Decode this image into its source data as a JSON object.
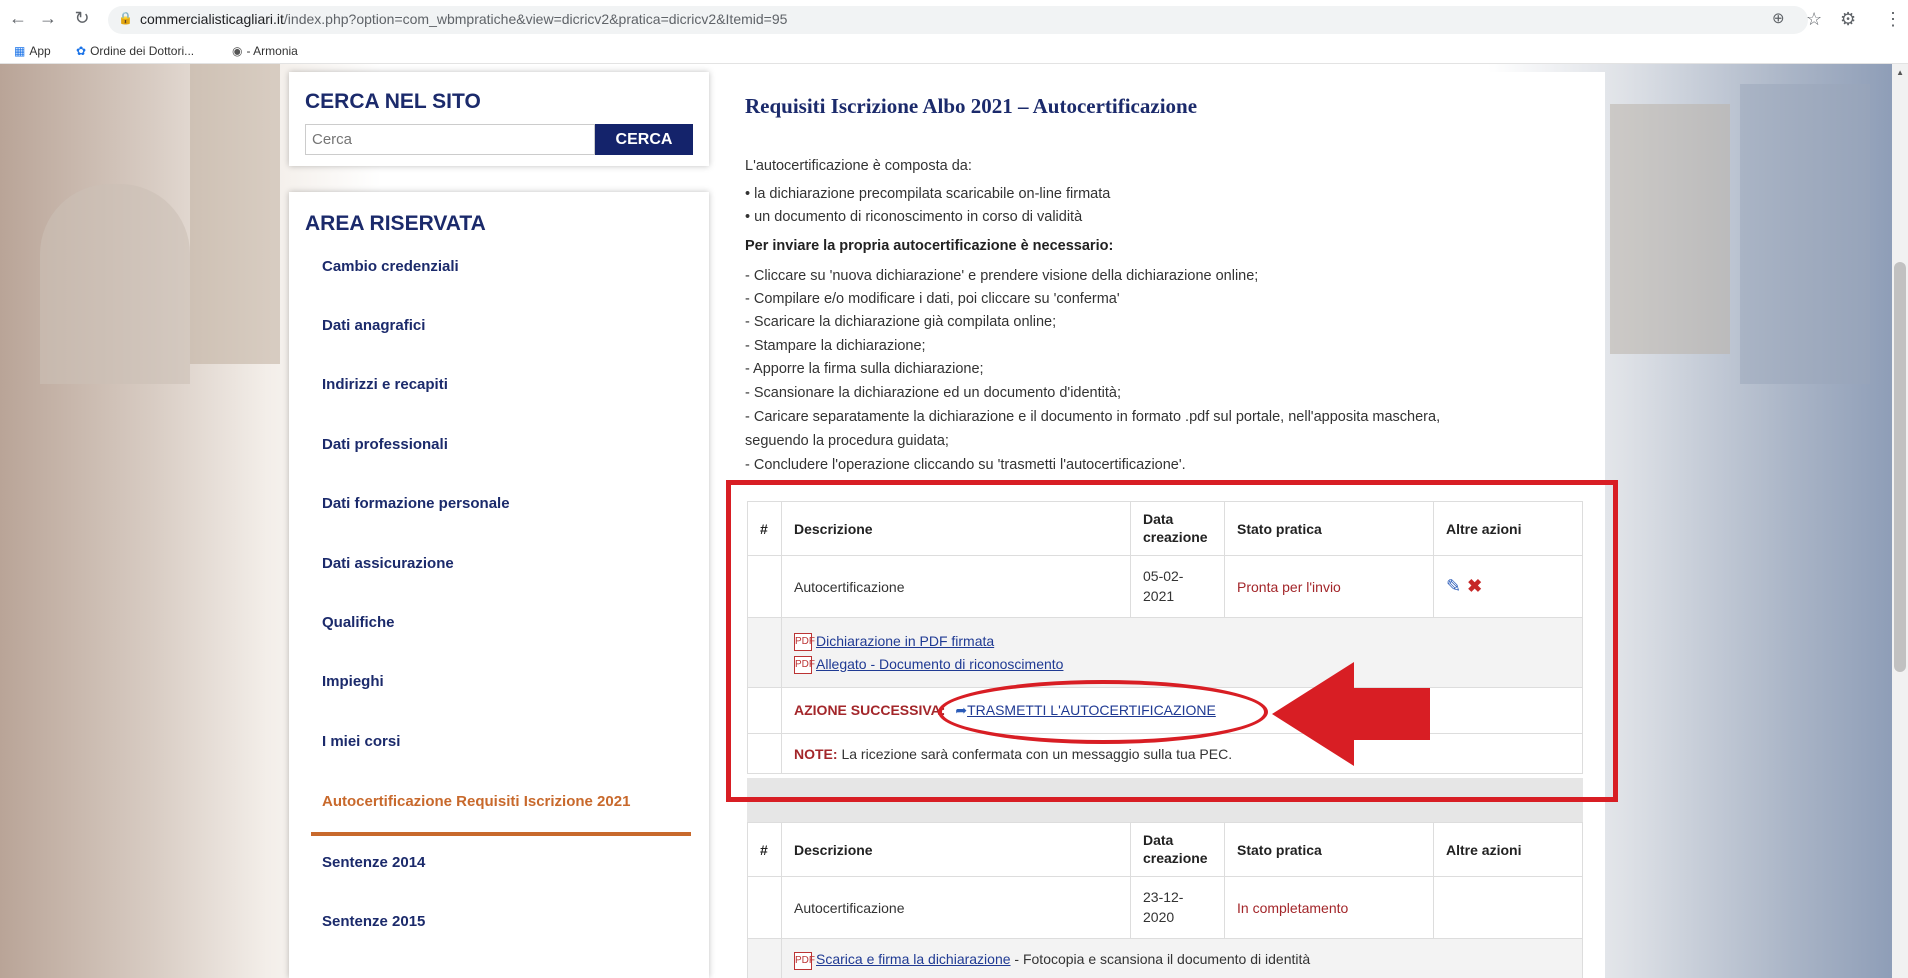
{
  "browser": {
    "url_domain": "commercialisticagliari.it",
    "url_rest": "/index.php?option=com_wbmpratiche&view=dicricv2&pratica=dicricv2&Itemid=95",
    "bookmarks": [
      "App",
      "Ordine dei Dottori...",
      "- Armonia"
    ]
  },
  "search": {
    "title": "CERCA NEL SITO",
    "placeholder": "Cerca",
    "button": "CERCA"
  },
  "area": {
    "title": "AREA RISERVATA",
    "items": [
      {
        "label": "Cambio credenziali"
      },
      {
        "label": "Dati anagrafici"
      },
      {
        "label": "Indirizzi e recapiti"
      },
      {
        "label": "Dati professionali"
      },
      {
        "label": "Dati formazione personale"
      },
      {
        "label": "Dati assicurazione"
      },
      {
        "label": "Qualifiche"
      },
      {
        "label": "Impieghi"
      },
      {
        "label": "I miei corsi"
      },
      {
        "label": "Autocertificazione Requisiti Iscrizione 2021"
      },
      {
        "label": "Sentenze 2014"
      },
      {
        "label": "Sentenze 2015"
      }
    ]
  },
  "main": {
    "title": "Requisiti Iscrizione Albo 2021 – Autocertificazione",
    "intro": "L'autocertificazione è composta da:",
    "bullets": [
      "• la dichiarazione precompilata scaricabile on-line firmata",
      "• un documento di riconoscimento in corso di validità"
    ],
    "steps_title": "Per inviare la propria autocertificazione è necessario:",
    "steps": [
      "- Cliccare su 'nuova dichiarazione' e prendere visione della dichiarazione online;",
      "- Compilare e/o modificare i dati, poi cliccare su 'conferma'",
      "- Scaricare la dichiarazione già compilata online;",
      "- Stampare la dichiarazione;",
      "- Apporre la firma sulla dichiarazione;",
      "- Scansionare la dichiarazione ed un documento d'identità;",
      "- Caricare separatamente la dichiarazione e il documento in formato .pdf sul portale, nell'apposita maschera,",
      "seguendo la procedura guidata;",
      "- Concludere l'operazione cliccando su 'trasmetti l'autocertificazione'."
    ],
    "table_headers": {
      "num": "#",
      "desc": "Descrizione",
      "date_1": "Data",
      "date_2": "creazione",
      "status": "Stato pratica",
      "actions": "Altre azioni"
    },
    "table1": {
      "desc": "Autocertificazione",
      "date_1": "05-02-",
      "date_2": "2021",
      "status": "Pronta per l'invio",
      "link1": "Dichiarazione in PDF firmata",
      "link2": "Allegato - Documento di riconoscimento",
      "next_label": "AZIONE SUCCESSIVA:",
      "next_link": "TRASMETTI L'AUTOCERTIFICAZIONE",
      "note_label": "NOTE:",
      "note_text": "La ricezione sarà confermata con un messaggio sulla tua PEC."
    },
    "table2": {
      "desc": "Autocertificazione",
      "date_1": "23-12-",
      "date_2": "2020",
      "status": "In completamento",
      "link": "Scarica e firma la dichiarazione",
      "link_suffix": " - Fotocopia e scansiona il documento di identità"
    }
  },
  "colors": {
    "accent_navy": "#14236b",
    "active_orange": "#c8692c",
    "annotation_red": "#d81e24"
  }
}
